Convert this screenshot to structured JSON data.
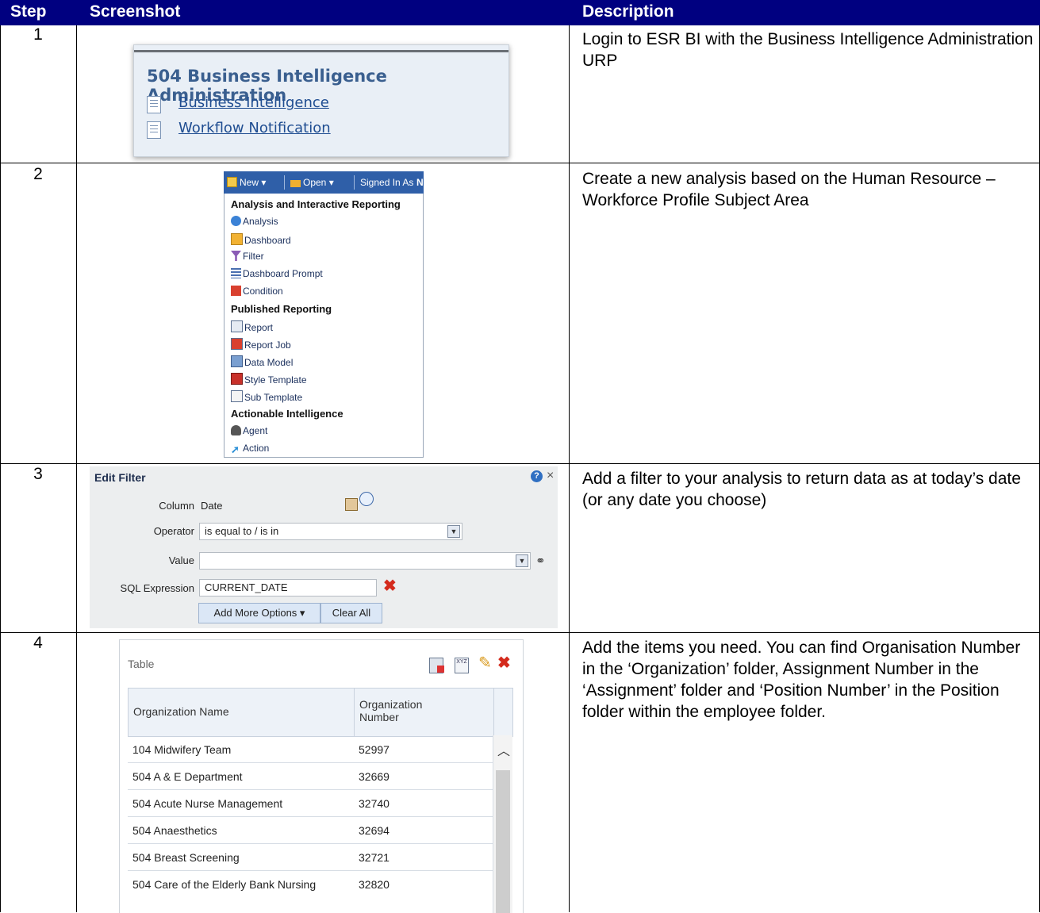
{
  "header": {
    "step": "Step",
    "screenshot": "Screenshot",
    "description": "Description"
  },
  "colors": {
    "header_bg": "#000080",
    "link": "#1f4d91",
    "title_blue": "#3a5f8f"
  },
  "rows": [
    {
      "step": "1",
      "description": "Login to ESR BI with the Business Intelligence Administration URP"
    },
    {
      "step": "2",
      "description": "Create a new analysis based on the Human Resource – Workforce Profile Subject Area"
    },
    {
      "step": "3",
      "description": "Add a filter to your analysis to return data as at today’s date (or any date you choose)"
    },
    {
      "step": "4",
      "description": "Add the items you need. You can find Organisation Number in the ‘Organization’ folder, Assignment Number in the ‘Assignment’ folder and ‘Position Number’ in the Position folder within the employee folder."
    }
  ],
  "step1": {
    "title": "504 Business Intelligence Administration",
    "links": [
      "Business Intelligence",
      "Workflow Notification"
    ],
    "icon": "document-icon"
  },
  "step2": {
    "toolbar": {
      "new": "New",
      "open": "Open",
      "signed_in": "Signed In As",
      "trailing": "N"
    },
    "menu": [
      {
        "label": "Analysis and Interactive Reporting",
        "kind": "heading"
      },
      {
        "label": "Analysis",
        "icon": "analysis-icon"
      },
      {
        "label": "Dashboard",
        "icon": "dashboard-icon"
      },
      {
        "label": "Filter",
        "icon": "filter-icon"
      },
      {
        "label": "Dashboard Prompt",
        "icon": "prompt-icon"
      },
      {
        "label": "Condition",
        "icon": "condition-icon"
      },
      {
        "label": "Published Reporting",
        "kind": "heading"
      },
      {
        "label": "Report",
        "icon": "report-icon"
      },
      {
        "label": "Report Job",
        "icon": "report-job-icon"
      },
      {
        "label": "Data Model",
        "icon": "data-model-icon"
      },
      {
        "label": "Style Template",
        "icon": "style-template-icon"
      },
      {
        "label": "Sub Template",
        "icon": "sub-template-icon"
      },
      {
        "label": "Actionable Intelligence",
        "kind": "heading"
      },
      {
        "label": "Agent",
        "icon": "agent-icon"
      },
      {
        "label": "Action",
        "icon": "action-icon"
      }
    ]
  },
  "step3": {
    "title": "Edit Filter",
    "column_label": "Column",
    "column_value": "Date",
    "operator_label": "Operator",
    "operator_value": "is equal to / is in",
    "value_label": "Value",
    "value_value": "",
    "sql_label": "SQL Expression",
    "sql_value": "CURRENT_DATE",
    "add_more": "Add More Options ▾",
    "clear_all": "Clear All"
  },
  "step4": {
    "title": "Table",
    "columns": [
      "Organization Name",
      "Organization Number"
    ],
    "rows": [
      [
        "104 Midwifery Team",
        "52997"
      ],
      [
        "504 A & E Department",
        "32669"
      ],
      [
        "504 Acute Nurse Management",
        "32740"
      ],
      [
        "504 Anaesthetics",
        "32694"
      ],
      [
        "504 Breast Screening",
        "32721"
      ],
      [
        "504 Care of the Elderly Bank Nursing",
        "32820"
      ]
    ]
  }
}
